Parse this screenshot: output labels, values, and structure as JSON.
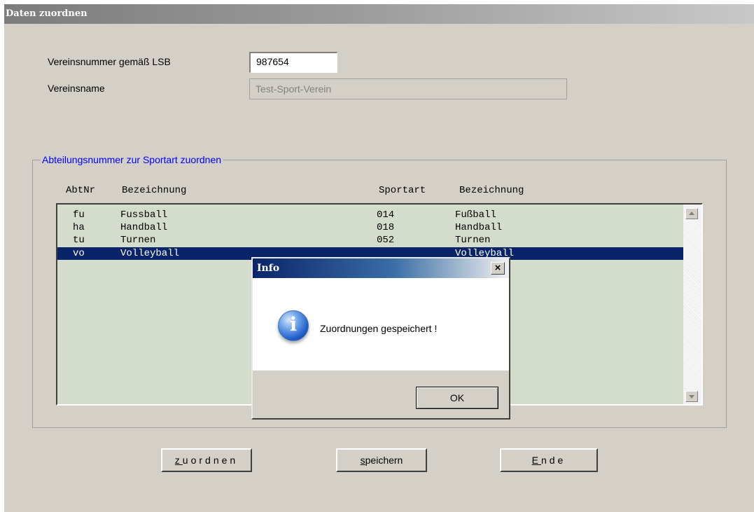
{
  "window": {
    "title": "Daten zuordnen"
  },
  "form": {
    "vereinsnummer_label": "Vereinsnummer gemäß LSB",
    "vereinsnummer_value": "987654",
    "vereinsname_label": "Vereinsname",
    "vereinsname_value": "Test-Sport-Verein"
  },
  "group": {
    "legend": "Abteilungsnummer zur Sportart zuordnen",
    "headers": {
      "abtnr": "AbtNr",
      "bezeichnung1": "Bezeichnung",
      "sportart": "Sportart",
      "bezeichnung2": "Bezeichnung"
    },
    "rows": [
      {
        "abtnr": "fu",
        "bez": "Fussball",
        "sportart": "014",
        "sbez": "Fußball",
        "selected": false
      },
      {
        "abtnr": "ha",
        "bez": "Handball",
        "sportart": "018",
        "sbez": "Handball",
        "selected": false
      },
      {
        "abtnr": "tu",
        "bez": "Turnen",
        "sportart": "052",
        "sbez": "Turnen",
        "selected": false
      },
      {
        "abtnr": "vo",
        "bez": "Volleyball",
        "sportart": "",
        "sbez": "Volleyball",
        "selected": true
      }
    ]
  },
  "buttons": {
    "zuordnen_accel": "z",
    "zuordnen_rest": "uordnen",
    "speichern_accel": "s",
    "speichern_rest": "peichern",
    "ende_accel": "E",
    "ende_rest": "nde"
  },
  "dialog": {
    "title": "Info",
    "close": "×",
    "message": "Zuordnungen gespeichert !",
    "ok": "OK",
    "icon": "info-icon"
  },
  "colors": {
    "selection": "#0a246a",
    "legend": "#0000ff",
    "list_bg": "#d4dccc"
  }
}
